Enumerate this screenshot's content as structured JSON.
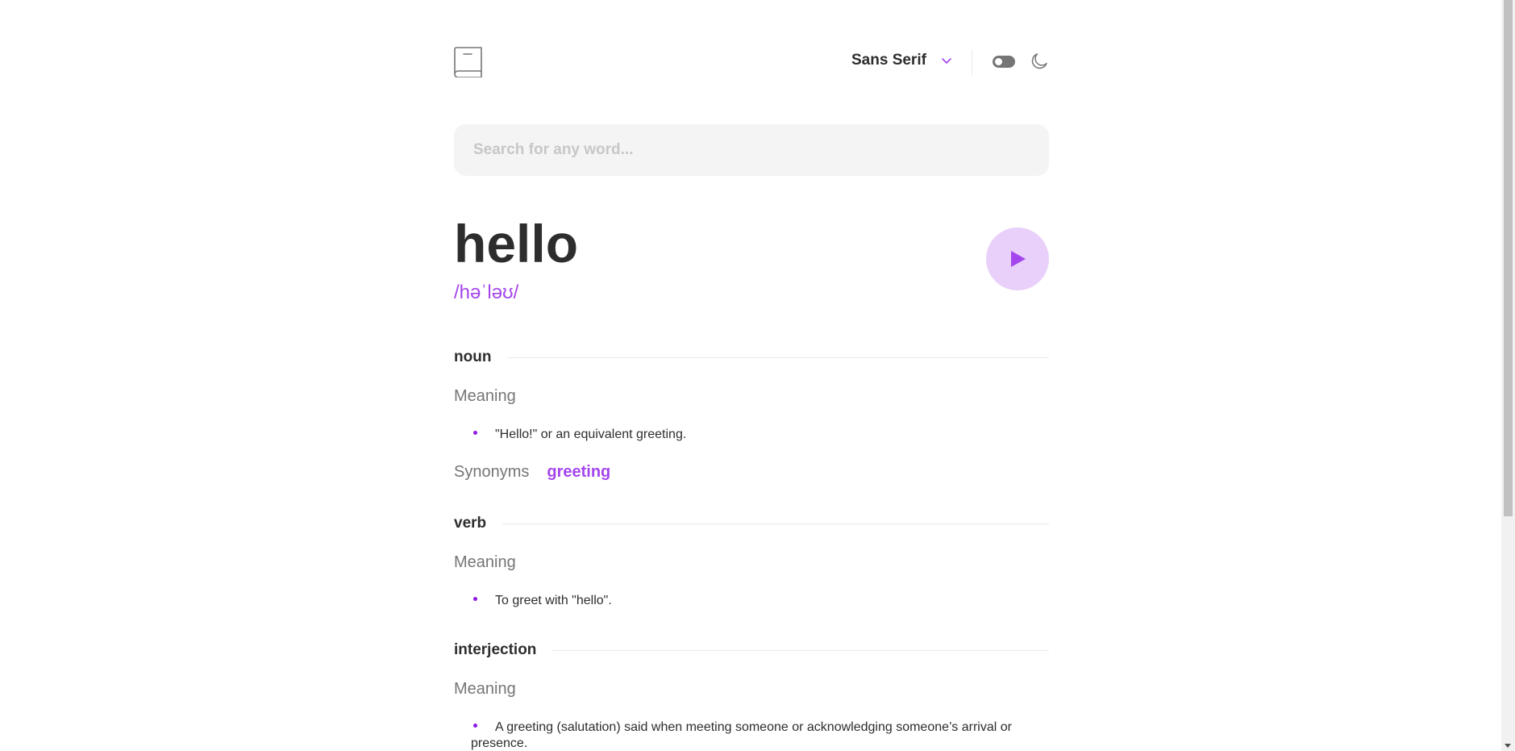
{
  "header": {
    "logo_icon": "book-icon",
    "font_selector": {
      "selected": "Sans Serif",
      "icon": "chevron-down-icon"
    },
    "theme_toggle": {
      "state": "off",
      "icon": "moon-icon"
    }
  },
  "search": {
    "placeholder": "Search for any word...",
    "value": ""
  },
  "entry": {
    "word": "hello",
    "phonetic": "/həˈləʊ/",
    "play_icon": "play-icon",
    "meanings": [
      {
        "part_of_speech": "noun",
        "meaning_label": "Meaning",
        "definitions": [
          "\"Hello!\" or an equivalent greeting."
        ],
        "synonyms_label": "Synonyms",
        "synonyms": [
          "greeting"
        ]
      },
      {
        "part_of_speech": "verb",
        "meaning_label": "Meaning",
        "definitions": [
          "To greet with \"hello\"."
        ]
      },
      {
        "part_of_speech": "interjection",
        "meaning_label": "Meaning",
        "definitions": [
          "A greeting (salutation) said when meeting someone or acknowledging someone’s arrival or presence."
        ]
      }
    ]
  },
  "colors": {
    "accent": "#a445ed",
    "accent_light": "#e9d0fa",
    "text": "#2d2d2d",
    "muted": "#757575",
    "search_bg": "#f4f4f4",
    "divider": "#e9e9e9"
  }
}
